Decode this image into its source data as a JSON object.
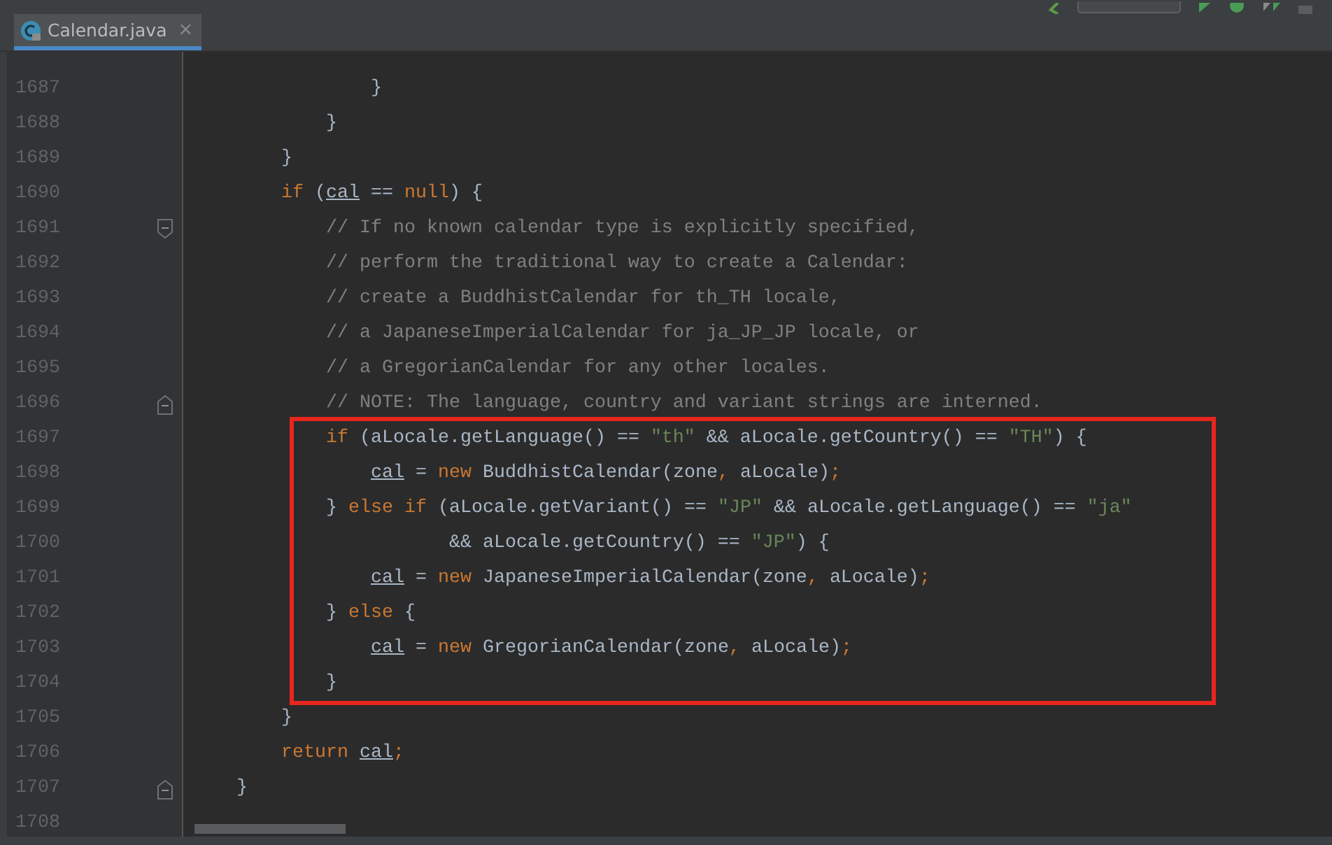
{
  "tabs": [
    {
      "label": "Calendar.java",
      "selected": true,
      "close": "×"
    }
  ],
  "lines": [
    {
      "number": "1687",
      "tokens": [
        {
          "kind": "text",
          "text": "                }"
        }
      ]
    },
    {
      "number": "1688",
      "tokens": [
        {
          "kind": "text",
          "text": "            }"
        }
      ]
    },
    {
      "number": "1689",
      "tokens": [
        {
          "kind": "text",
          "text": "        }"
        }
      ]
    },
    {
      "number": "1690",
      "tokens": [
        {
          "kind": "keyword",
          "text": "        if "
        },
        {
          "kind": "text",
          "text": "("
        },
        {
          "kind": "field",
          "text": "cal"
        },
        {
          "kind": "text",
          "text": " == "
        },
        {
          "kind": "keyword",
          "text": "null"
        },
        {
          "kind": "text",
          "text": ") {"
        }
      ]
    },
    {
      "number": "1691",
      "fold_start": true,
      "tokens": [
        {
          "kind": "comment",
          "text": "            // If no known calendar type is explicitly specified,"
        }
      ]
    },
    {
      "number": "1692",
      "tokens": [
        {
          "kind": "comment",
          "text": "            // perform the traditional way to create a Calendar:"
        }
      ]
    },
    {
      "number": "1693",
      "tokens": [
        {
          "kind": "comment",
          "text": "            // create a BuddhistCalendar for th_TH locale,"
        }
      ]
    },
    {
      "number": "1694",
      "tokens": [
        {
          "kind": "comment",
          "text": "            // a JapaneseImperialCalendar for ja_JP_JP locale, or"
        }
      ]
    },
    {
      "number": "1695",
      "tokens": [
        {
          "kind": "comment",
          "text": "            // a GregorianCalendar for any other locales."
        }
      ]
    },
    {
      "number": "1696",
      "fold_end": true,
      "tokens": [
        {
          "kind": "comment",
          "text": "            // NOTE: The language, country and variant strings are interned."
        }
      ]
    },
    {
      "number": "1697",
      "highlighted": true,
      "tokens": [
        {
          "kind": "keyword",
          "text": "            if "
        },
        {
          "kind": "text",
          "text": "(aLocale.getLanguage() == "
        },
        {
          "kind": "string",
          "text": "\"th\""
        },
        {
          "kind": "text",
          "text": " && aLocale.getCountry() == "
        },
        {
          "kind": "string",
          "text": "\"TH\""
        },
        {
          "kind": "text",
          "text": ") {"
        }
      ]
    },
    {
      "number": "1698",
      "highlighted": true,
      "tokens": [
        {
          "kind": "field",
          "text": "                cal"
        },
        {
          "kind": "text",
          "text": " = "
        },
        {
          "kind": "keyword",
          "text": "new "
        },
        {
          "kind": "text",
          "text": "BuddhistCalendar(zone"
        },
        {
          "kind": "punct",
          "text": ", "
        },
        {
          "kind": "text",
          "text": "aLocale)"
        },
        {
          "kind": "punct",
          "text": ";"
        }
      ]
    },
    {
      "number": "1699",
      "highlighted": true,
      "tokens": [
        {
          "kind": "text",
          "text": "            } "
        },
        {
          "kind": "keyword",
          "text": "else if "
        },
        {
          "kind": "text",
          "text": "(aLocale.getVariant() == "
        },
        {
          "kind": "string",
          "text": "\"JP\""
        },
        {
          "kind": "text",
          "text": " && aLocale.getLanguage() == "
        },
        {
          "kind": "string",
          "text": "\"ja\""
        }
      ]
    },
    {
      "number": "1700",
      "highlighted": true,
      "tokens": [
        {
          "kind": "text",
          "text": "                       && aLocale.getCountry() == "
        },
        {
          "kind": "string",
          "text": "\"JP\""
        },
        {
          "kind": "text",
          "text": ") {"
        }
      ]
    },
    {
      "number": "1701",
      "highlighted": true,
      "tokens": [
        {
          "kind": "field",
          "text": "                cal"
        },
        {
          "kind": "text",
          "text": " = "
        },
        {
          "kind": "keyword",
          "text": "new "
        },
        {
          "kind": "text",
          "text": "JapaneseImperialCalendar(zone"
        },
        {
          "kind": "punct",
          "text": ", "
        },
        {
          "kind": "text",
          "text": "aLocale)"
        },
        {
          "kind": "punct",
          "text": ";"
        }
      ]
    },
    {
      "number": "1702",
      "highlighted": true,
      "tokens": [
        {
          "kind": "text",
          "text": "            } "
        },
        {
          "kind": "keyword",
          "text": "else "
        },
        {
          "kind": "text",
          "text": "{"
        }
      ]
    },
    {
      "number": "1703",
      "highlighted": true,
      "tokens": [
        {
          "kind": "field",
          "text": "                cal"
        },
        {
          "kind": "text",
          "text": " = "
        },
        {
          "kind": "keyword",
          "text": "new "
        },
        {
          "kind": "text",
          "text": "GregorianCalendar(zone"
        },
        {
          "kind": "punct",
          "text": ", "
        },
        {
          "kind": "text",
          "text": "aLocale)"
        },
        {
          "kind": "punct",
          "text": ";"
        }
      ]
    },
    {
      "number": "1704",
      "highlighted": true,
      "tokens": [
        {
          "kind": "text",
          "text": "            }"
        }
      ]
    },
    {
      "number": "1705",
      "tokens": [
        {
          "kind": "text",
          "text": "        }"
        }
      ]
    },
    {
      "number": "1706",
      "tokens": [
        {
          "kind": "keyword",
          "text": "        return "
        },
        {
          "kind": "field",
          "text": "cal"
        },
        {
          "kind": "punct",
          "text": ";"
        }
      ]
    },
    {
      "number": "1707",
      "fold_end": true,
      "tokens": [
        {
          "kind": "text",
          "text": "    }"
        }
      ]
    },
    {
      "number": "1708"
    }
  ]
}
